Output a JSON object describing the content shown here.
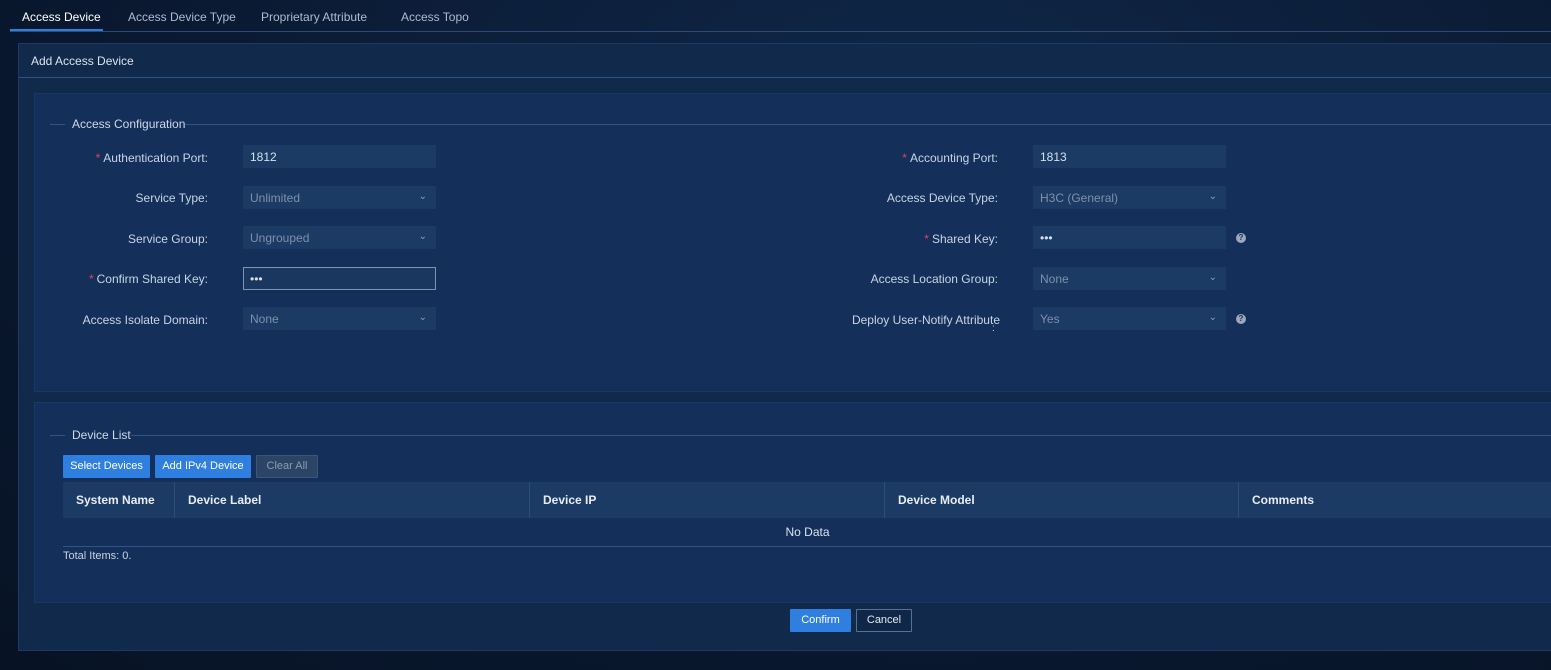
{
  "tabs": [
    {
      "label": "Access Device",
      "active": true
    },
    {
      "label": "Access Device Type"
    },
    {
      "label": "Proprietary Attribute"
    },
    {
      "label": "Access Topo"
    }
  ],
  "panel": {
    "title": "Add Access Device"
  },
  "access_config": {
    "legend": "Access Configuration",
    "fields": {
      "auth_port": {
        "label": "Authentication Port:",
        "required": true,
        "value": "1812"
      },
      "service_type": {
        "label": "Service Type:",
        "value": "Unlimited"
      },
      "service_group": {
        "label": "Service Group:",
        "value": "Ungrouped"
      },
      "confirm_shared_key": {
        "label": "Confirm Shared Key:",
        "required": true,
        "value": "•••"
      },
      "isolate_domain": {
        "label": "Access Isolate Domain:",
        "value": "None"
      },
      "accounting_port": {
        "label": "Accounting Port:",
        "required": true,
        "value": "1813"
      },
      "device_type": {
        "label": "Access Device Type:",
        "value": "H3C (General)"
      },
      "shared_key": {
        "label": "Shared Key:",
        "required": true,
        "value": "•••"
      },
      "location_group": {
        "label": "Access Location Group:",
        "value": "None"
      },
      "user_notify": {
        "label": "Deploy User-Notify Attribute",
        "label_suffix": ":",
        "value": "Yes"
      }
    }
  },
  "device_list": {
    "legend": "Device List",
    "buttons": {
      "select": "Select Devices",
      "add_ipv4": "Add IPv4 Device",
      "clear_all": "Clear All"
    },
    "columns": [
      "System Name",
      "Device Label",
      "Device IP",
      "Device Model",
      "Comments"
    ],
    "empty_text": "No Data",
    "total_text": "Total Items: 0."
  },
  "footer": {
    "confirm": "Confirm",
    "cancel": "Cancel"
  },
  "icons": {
    "chevron": "chevron-down-icon",
    "help": "help-circle-icon"
  },
  "colors": {
    "accent": "#2f7fe0",
    "required": "#e0445a",
    "panel": "#112a4b"
  }
}
